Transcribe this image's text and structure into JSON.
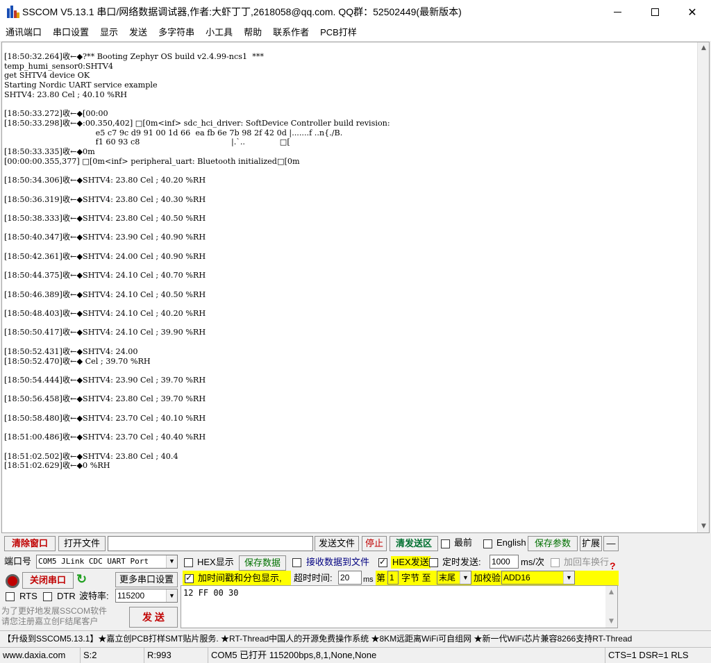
{
  "window": {
    "title": "SSCOM V5.13.1 串口/网络数据调试器,作者:大虾丁丁,2618058@qq.com. QQ群：52502449(最新版本)",
    "icon": "sscom-logo-icon"
  },
  "menu": [
    "通讯端口",
    "串口设置",
    "显示",
    "发送",
    "多字符串",
    "小工具",
    "帮助",
    "联系作者",
    "PCB打样"
  ],
  "receive": {
    "lines": [
      "[18:50:32.264]收←◆?** Booting Zephyr OS build v2.4.99-ncs1  ***",
      "temp_humi_sensor0:SHTV4",
      "get SHTV4 device OK",
      "Starting Nordic UART service example",
      "SHTV4: 23.80 Cel ; 40.10 %RH",
      "",
      "[18:50:33.272]收←◆[00:00",
      "[18:50:33.298]收←◆:00.350,402] □[0m<inf> sdc_hci_driver: SoftDevice Controller build revision:",
      "                                     e5 c7 9c d9 91 00 1d 66  ea fb 6e 7b 98 2f 42 0d |.......f ..n{./B.",
      "                                     f1 60 93 c8                                     |.`..              □[",
      "[18:50:33.335]收←◆0m",
      "[00:00:00.355,377] □[0m<inf> peripheral_uart: Bluetooth initialized□[0m",
      "",
      "[18:50:34.306]收←◆SHTV4: 23.80 Cel ; 40.20 %RH",
      "",
      "[18:50:36.319]收←◆SHTV4: 23.80 Cel ; 40.30 %RH",
      "",
      "[18:50:38.333]收←◆SHTV4: 23.80 Cel ; 40.50 %RH",
      "",
      "[18:50:40.347]收←◆SHTV4: 23.90 Cel ; 40.90 %RH",
      "",
      "[18:50:42.361]收←◆SHTV4: 24.00 Cel ; 40.90 %RH",
      "",
      "[18:50:44.375]收←◆SHTV4: 24.10 Cel ; 40.70 %RH",
      "",
      "[18:50:46.389]收←◆SHTV4: 24.10 Cel ; 40.50 %RH",
      "",
      "[18:50:48.403]收←◆SHTV4: 24.10 Cel ; 40.20 %RH",
      "",
      "[18:50:50.417]收←◆SHTV4: 24.10 Cel ; 39.90 %RH",
      "",
      "[18:50:52.431]收←◆SHTV4: 24.00",
      "[18:50:52.470]收←◆ Cel ; 39.70 %RH",
      "",
      "[18:50:54.444]收←◆SHTV4: 23.90 Cel ; 39.70 %RH",
      "",
      "[18:50:56.458]收←◆SHTV4: 23.80 Cel ; 39.70 %RH",
      "",
      "[18:50:58.480]收←◆SHTV4: 23.70 Cel ; 40.10 %RH",
      "",
      "[18:51:00.486]收←◆SHTV4: 23.70 Cel ; 40.40 %RH",
      "",
      "[18:51:02.502]收←◆SHTV4: 23.80 Cel ; 40.4",
      "[18:51:02.629]收←◆0 %RH"
    ]
  },
  "toolbar": {
    "clear_window": "清除窗口",
    "open_file": "打开文件",
    "send_file": "发送文件",
    "stop": "停止",
    "clear_send": "清发送区",
    "front": "最前",
    "english": "English",
    "save_params": "保存参数",
    "expand": "扩展",
    "collapse": "—"
  },
  "port": {
    "label": "端口号",
    "value": "COM5 JLink CDC UART Port",
    "close_port": "关闭串口",
    "more_settings": "更多串口设置",
    "rts": "RTS",
    "dtr": "DTR",
    "baud_label": "波特率:",
    "baud_value": "115200"
  },
  "options": {
    "hex_display": "HEX显示",
    "save_data": "保存数据",
    "recv_to_file": "接收数据到文件",
    "hex_send": "HEX发送",
    "timed_send": "定时发送:",
    "interval": "1000",
    "interval_unit": "ms/次",
    "add_crlf": "加回车换行",
    "timestamp": "加时间戳和分包显示,",
    "timeout_label": "超时时间:",
    "timeout_value": "20",
    "timeout_unit": "ms",
    "nth_label": "第",
    "nth_value": "1",
    "byte_to": "字节 至",
    "end": "末尾",
    "checksum_label": "加校验",
    "checksum_value": "ADD16"
  },
  "send": {
    "text": "12 FF 00 30",
    "button": "发 送"
  },
  "promo": {
    "line1": "为了更好地发展SSCOM软件",
    "line2": "请您注册嘉立创F结尾客户"
  },
  "banner": "【升级到SSCOM5.13.1】★嘉立创PCB打样SMT贴片服务. ★RT-Thread中国人的开源免费操作系统 ★8KM远距离WiFi可自组网 ★新一代WiFi芯片兼容8266支持RT-Thread",
  "status": {
    "site": "www.daxia.com",
    "sent": "S:2",
    "received": "R:993",
    "port_state": "COM5 已打开  115200bps,8,1,None,None",
    "lines": "CTS=1 DSR=1 RLS"
  },
  "colors": {
    "highlight_yellow": "#ffff00",
    "clear_red": "#c00000",
    "save_green": "#007000"
  }
}
